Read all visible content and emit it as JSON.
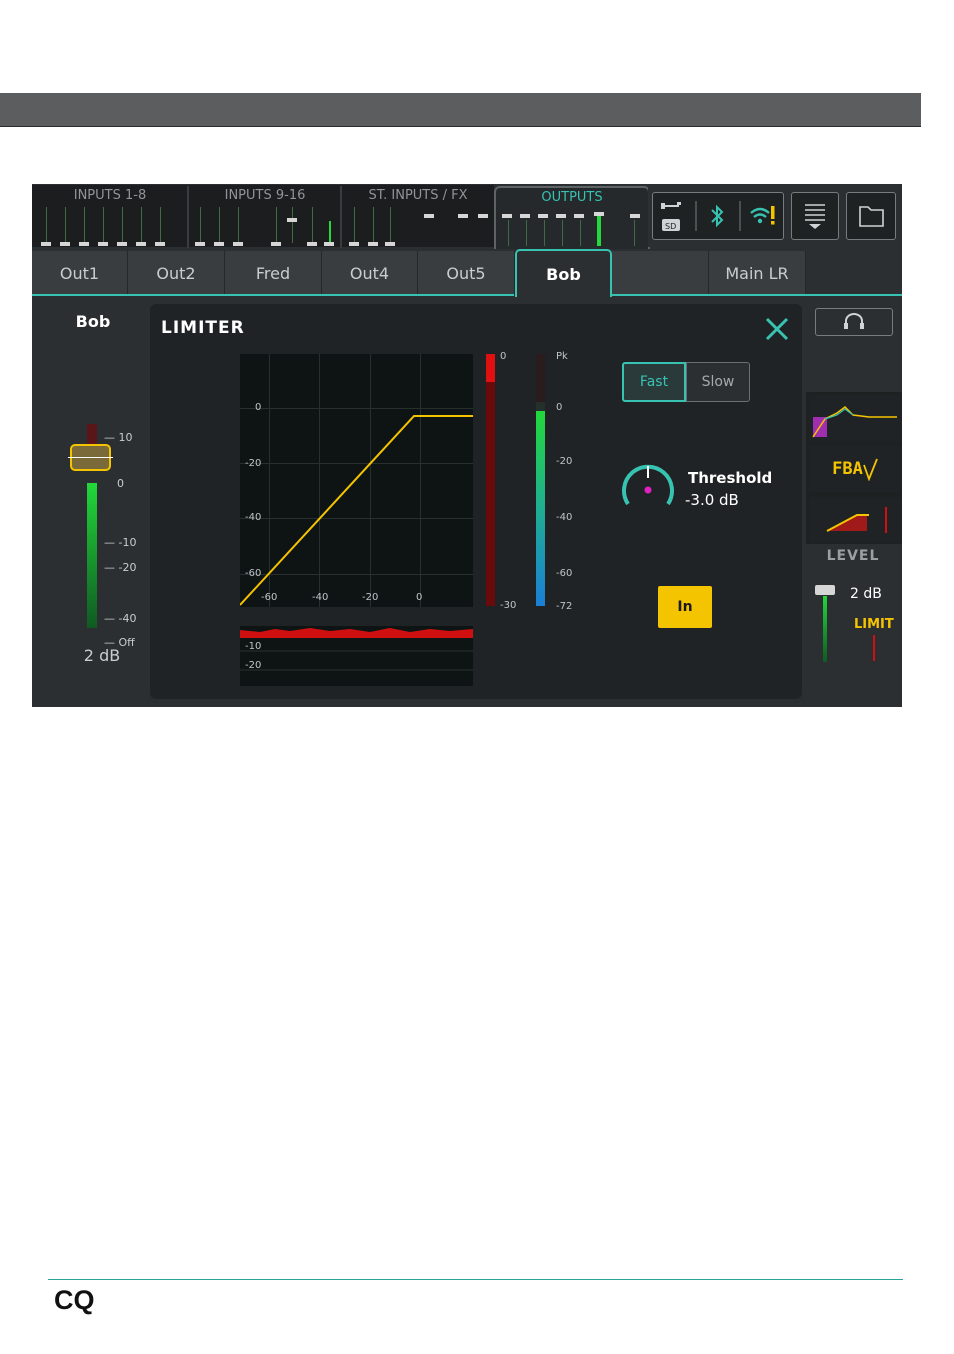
{
  "topbar": {
    "banks": [
      {
        "label": "INPUTS 1-8"
      },
      {
        "label": "INPUTS 9-16"
      },
      {
        "label": "ST. INPUTS / FX"
      },
      {
        "label": "OUTPUTS"
      }
    ],
    "icons": [
      "usb-sd-icon",
      "bluetooth-icon",
      "wifi-warning-icon",
      "menu-icon",
      "folder-icon"
    ]
  },
  "tabs": [
    {
      "label": "Out1"
    },
    {
      "label": "Out2"
    },
    {
      "label": "Fred"
    },
    {
      "label": "Out4"
    },
    {
      "label": "Out5"
    },
    {
      "label": "Bob"
    },
    {
      "label": ""
    },
    {
      "label": "Main LR"
    }
  ],
  "channel": {
    "name": "Bob",
    "level": "2 dB",
    "fader_ticks": [
      "10",
      "0",
      "-10",
      "-20",
      "-40",
      "Off"
    ]
  },
  "limiter": {
    "title": "LIMITER",
    "graph_y_ticks": [
      "0",
      "-20",
      "-40",
      "-60"
    ],
    "graph_x_ticks": [
      "-60",
      "-40",
      "-20",
      "0"
    ],
    "gr_meter_top": "0",
    "gr_meter_bottom": "-30",
    "pk_labels": [
      "Pk",
      "0",
      "-20",
      "-40",
      "-60",
      "-72"
    ],
    "history_ticks": [
      "-10",
      "-20"
    ],
    "speed_fast": "Fast",
    "speed_slow": "Slow",
    "threshold_label": "Threshold",
    "threshold_value": "-3.0 dB",
    "in_button": "In"
  },
  "right_panel": {
    "level_label": "LEVEL",
    "level_value": "2 dB",
    "limit_label": "LIMIT",
    "fba_label": "FBA"
  },
  "footer": {
    "logo": "CQ"
  },
  "colors": {
    "accent": "#37c2b2",
    "yellow": "#f5c400",
    "meter_green": "#22d83a",
    "meter_red": "#e01010"
  }
}
